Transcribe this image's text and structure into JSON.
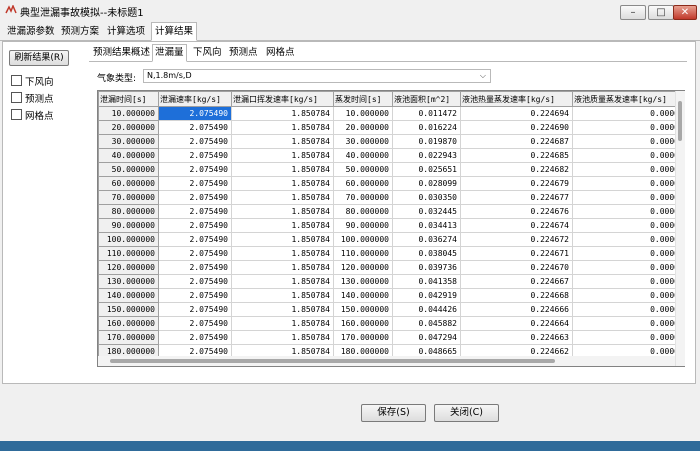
{
  "window": {
    "title": "典型泄漏事故模拟--未标题1",
    "minimize": "–",
    "maximize": "□",
    "close": "✕"
  },
  "top_tabs": [
    "泄漏源参数",
    "预测方案",
    "计算选项",
    "计算结果"
  ],
  "sidebar": {
    "refresh_label": "刷新结果(R)",
    "checkboxes": [
      "下风向",
      "预测点",
      "网格点"
    ]
  },
  "inner_tabs": [
    "预测结果概述",
    "泄漏量",
    "下风向",
    "预测点",
    "网格点"
  ],
  "weather": {
    "label": "气象类型:",
    "value": "N,1.8m/s,D"
  },
  "table": {
    "columns": [
      "泄漏时间[s]",
      "泄漏速率[kg/s]",
      "泄漏口挥发速率[kg/s]",
      "蒸发时间[s]",
      "液池面积[m^2]",
      "液池热量蒸发速率[kg/s]",
      "液池质量蒸发速率[kg/s]"
    ],
    "rows": [
      [
        "10.000000",
        "2.075490",
        "1.850784",
        "10.000000",
        "0.011472",
        "0.224694",
        "0.0000"
      ],
      [
        "20.000000",
        "2.075490",
        "1.850784",
        "20.000000",
        "0.016224",
        "0.224690",
        "0.0000"
      ],
      [
        "30.000000",
        "2.075490",
        "1.850784",
        "30.000000",
        "0.019870",
        "0.224687",
        "0.0000"
      ],
      [
        "40.000000",
        "2.075490",
        "1.850784",
        "40.000000",
        "0.022943",
        "0.224685",
        "0.0000"
      ],
      [
        "50.000000",
        "2.075490",
        "1.850784",
        "50.000000",
        "0.025651",
        "0.224682",
        "0.0000"
      ],
      [
        "60.000000",
        "2.075490",
        "1.850784",
        "60.000000",
        "0.028099",
        "0.224679",
        "0.0000"
      ],
      [
        "70.000000",
        "2.075490",
        "1.850784",
        "70.000000",
        "0.030350",
        "0.224677",
        "0.0000"
      ],
      [
        "80.000000",
        "2.075490",
        "1.850784",
        "80.000000",
        "0.032445",
        "0.224676",
        "0.0000"
      ],
      [
        "90.000000",
        "2.075490",
        "1.850784",
        "90.000000",
        "0.034413",
        "0.224674",
        "0.0000"
      ],
      [
        "100.000000",
        "2.075490",
        "1.850784",
        "100.000000",
        "0.036274",
        "0.224672",
        "0.0000"
      ],
      [
        "110.000000",
        "2.075490",
        "1.850784",
        "110.000000",
        "0.038045",
        "0.224671",
        "0.0000"
      ],
      [
        "120.000000",
        "2.075490",
        "1.850784",
        "120.000000",
        "0.039736",
        "0.224670",
        "0.0000"
      ],
      [
        "130.000000",
        "2.075490",
        "1.850784",
        "130.000000",
        "0.041358",
        "0.224667",
        "0.0000"
      ],
      [
        "140.000000",
        "2.075490",
        "1.850784",
        "140.000000",
        "0.042919",
        "0.224668",
        "0.0000"
      ],
      [
        "150.000000",
        "2.075490",
        "1.850784",
        "150.000000",
        "0.044426",
        "0.224666",
        "0.0000"
      ],
      [
        "160.000000",
        "2.075490",
        "1.850784",
        "160.000000",
        "0.045882",
        "0.224664",
        "0.0000"
      ],
      [
        "170.000000",
        "2.075490",
        "1.850784",
        "170.000000",
        "0.047294",
        "0.224663",
        "0.0000"
      ],
      [
        "180.000000",
        "2.075490",
        "1.850784",
        "180.000000",
        "0.048665",
        "0.224662",
        "0.0000"
      ]
    ]
  },
  "buttons": {
    "save": "保存(S)",
    "close": "关闭(C)"
  },
  "colors": {
    "selection": "#1e6fd9",
    "close_button": "#c0392b",
    "taskbar": "#2f6b9a"
  }
}
